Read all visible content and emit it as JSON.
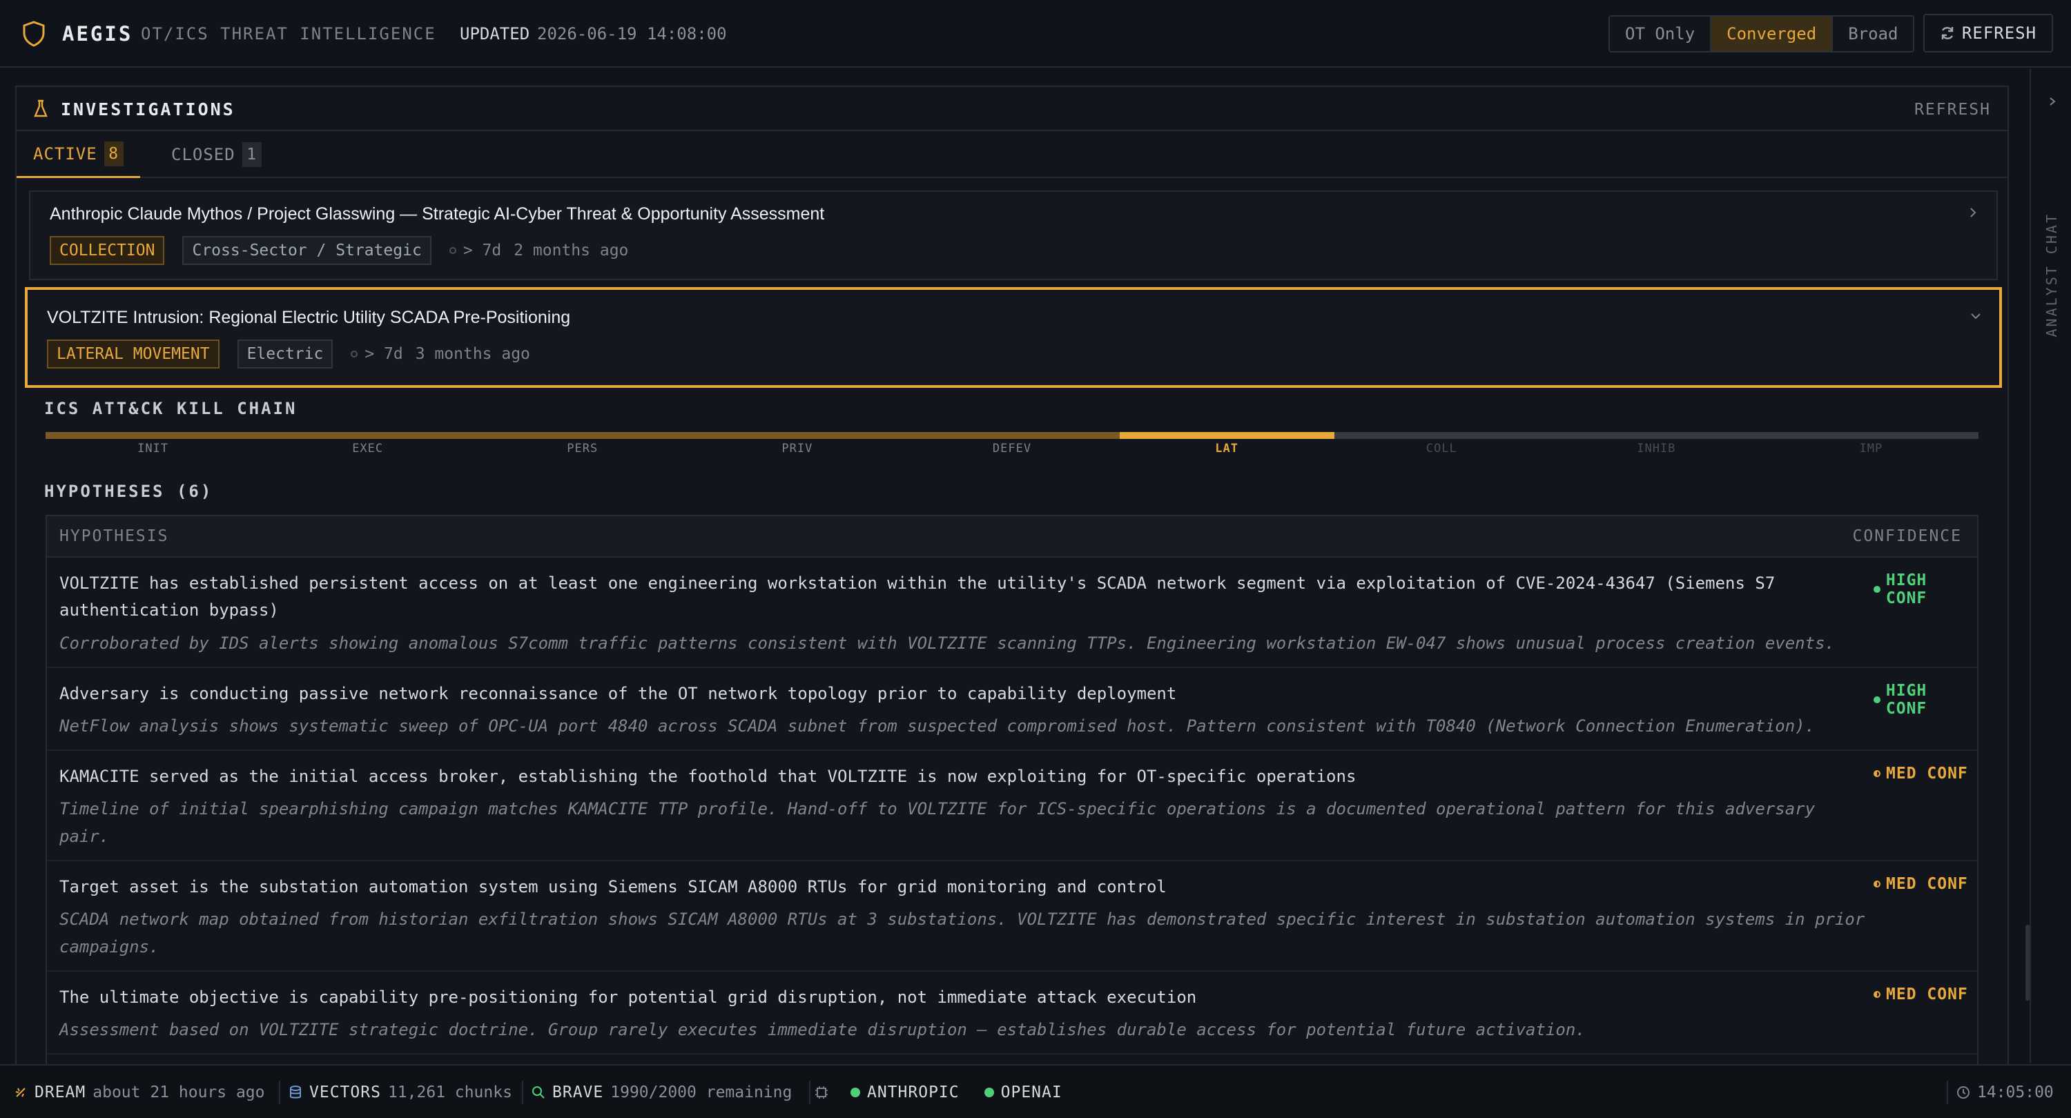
{
  "header": {
    "app_name": "AEGIS",
    "app_subtitle": "OT/ICS THREAT INTELLIGENCE",
    "updated_label": "UPDATED",
    "updated_value": "2026-06-19 14:08:00",
    "scope_options": [
      "OT Only",
      "Converged",
      "Broad"
    ],
    "scope_selected": "Converged",
    "refresh_label": "REFRESH"
  },
  "panel": {
    "title": "INVESTIGATIONS",
    "refresh_label": "REFRESH",
    "tabs": [
      {
        "label": "ACTIVE",
        "count": "8",
        "active": true
      },
      {
        "label": "CLOSED",
        "count": "1",
        "active": false
      }
    ]
  },
  "investigations": [
    {
      "title": "Anthropic Claude Mythos / Project Glasswing — Strategic AI-Cyber Threat & Opportunity Assessment",
      "stage": "COLLECTION",
      "sector": "Cross-Sector / Strategic",
      "age": "> 7d",
      "updated": "2 months ago",
      "expanded": false
    },
    {
      "title": "VOLTZITE Intrusion: Regional Electric Utility SCADA Pre-Positioning",
      "stage": "LATERAL MOVEMENT",
      "sector": "Electric",
      "age": "> 7d",
      "updated": "3 months ago",
      "expanded": true
    }
  ],
  "kill_chain": {
    "title": "ICS ATT&CK KILL CHAIN",
    "stages": [
      "INIT",
      "EXEC",
      "PERS",
      "PRIV",
      "DEFEV",
      "LAT",
      "COLL",
      "INHIB",
      "IMP"
    ],
    "current_stage": "LAT",
    "completed_count": 5
  },
  "hypotheses": {
    "title": "HYPOTHESES (6)",
    "col_hypothesis": "HYPOTHESIS",
    "col_confidence": "CONFIDENCE",
    "rows": [
      {
        "text": "VOLTZITE has established persistent access on at least one engineering workstation within the utility's SCADA network segment via exploitation of CVE-2024-43647 (Siemens S7 authentication bypass)",
        "note": "Corroborated by IDS alerts showing anomalous S7comm traffic patterns consistent with VOLTZITE scanning TTPs. Engineering workstation EW-047 shows unusual process creation events.",
        "confidence": "HIGH CONF",
        "level": "high"
      },
      {
        "text": "Adversary is conducting passive network reconnaissance of the OT network topology prior to capability deployment",
        "note": "NetFlow analysis shows systematic sweep of OPC-UA port 4840 across SCADA subnet from suspected compromised host. Pattern consistent with T0840 (Network Connection Enumeration).",
        "confidence": "HIGH CONF",
        "level": "high"
      },
      {
        "text": "KAMACITE served as the initial access broker, establishing the foothold that VOLTZITE is now exploiting for OT-specific operations",
        "note": "Timeline of initial spearphishing campaign matches KAMACITE TTP profile. Hand-off to VOLTZITE for ICS-specific operations is a documented operational pattern for this adversary pair.",
        "confidence": "MED CONF",
        "level": "med"
      },
      {
        "text": "Target asset is the substation automation system using Siemens SICAM A8000 RTUs for grid monitoring and control",
        "note": "SCADA network map obtained from historian exfiltration shows SICAM A8000 RTUs at 3 substations. VOLTZITE has demonstrated specific interest in substation automation systems in prior campaigns.",
        "confidence": "MED CONF",
        "level": "med"
      },
      {
        "text": "The ultimate objective is capability pre-positioning for potential grid disruption, not immediate attack execution",
        "note": "Assessment based on VOLTZITE strategic doctrine. Group rarely executes immediate disruption — establishes durable access for potential future activation.",
        "confidence": "MED CONF",
        "level": "med"
      }
    ]
  },
  "rail": {
    "label": "ANALYST CHAT"
  },
  "status": {
    "dream_label": "DREAM",
    "dream_value": "about 21 hours ago",
    "vectors_label": "VECTORS",
    "vectors_value": "11,261 chunks",
    "brave_label": "BRAVE",
    "brave_value": "1990/2000 remaining",
    "provider_1": "ANTHROPIC",
    "provider_2": "OPENAI",
    "clock": "14:05:00"
  },
  "colors": {
    "accent": "#e8a83a",
    "high": "#4fd07a",
    "background": "#101319"
  }
}
